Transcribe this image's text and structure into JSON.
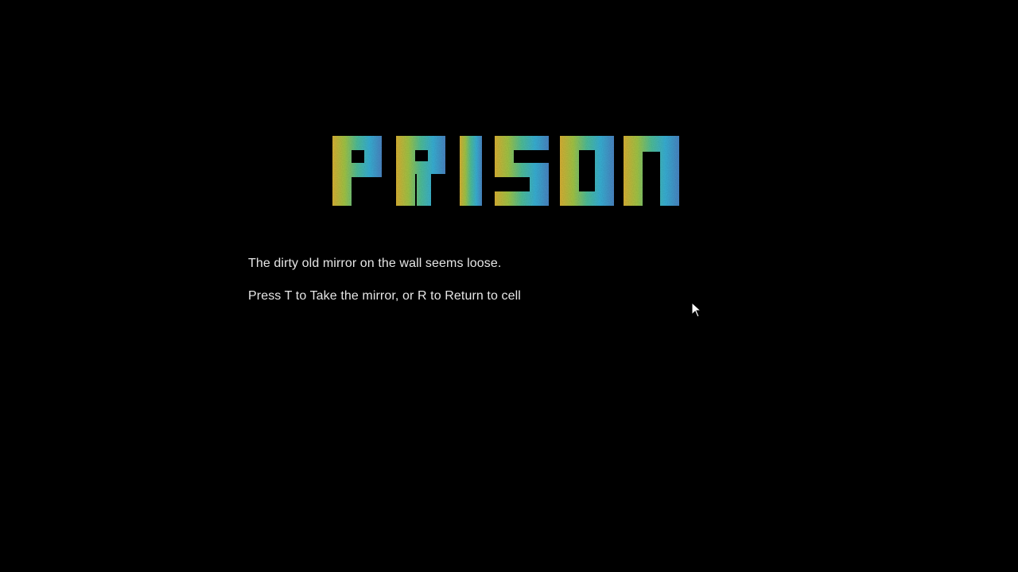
{
  "game": {
    "title": "PRISON",
    "title_gradient": [
      "#d6b53a",
      "#9fc64a",
      "#52c39a",
      "#3bb3d4",
      "#3f8fc9"
    ],
    "background": "#000000",
    "text_color": "#e6e6e6"
  },
  "narration": {
    "description": "The dirty old mirror on the wall seems loose.",
    "prompt": "Press T to Take the mirror, or R to Return to cell"
  },
  "cursor": {
    "icon": "arrow-cursor-icon"
  }
}
